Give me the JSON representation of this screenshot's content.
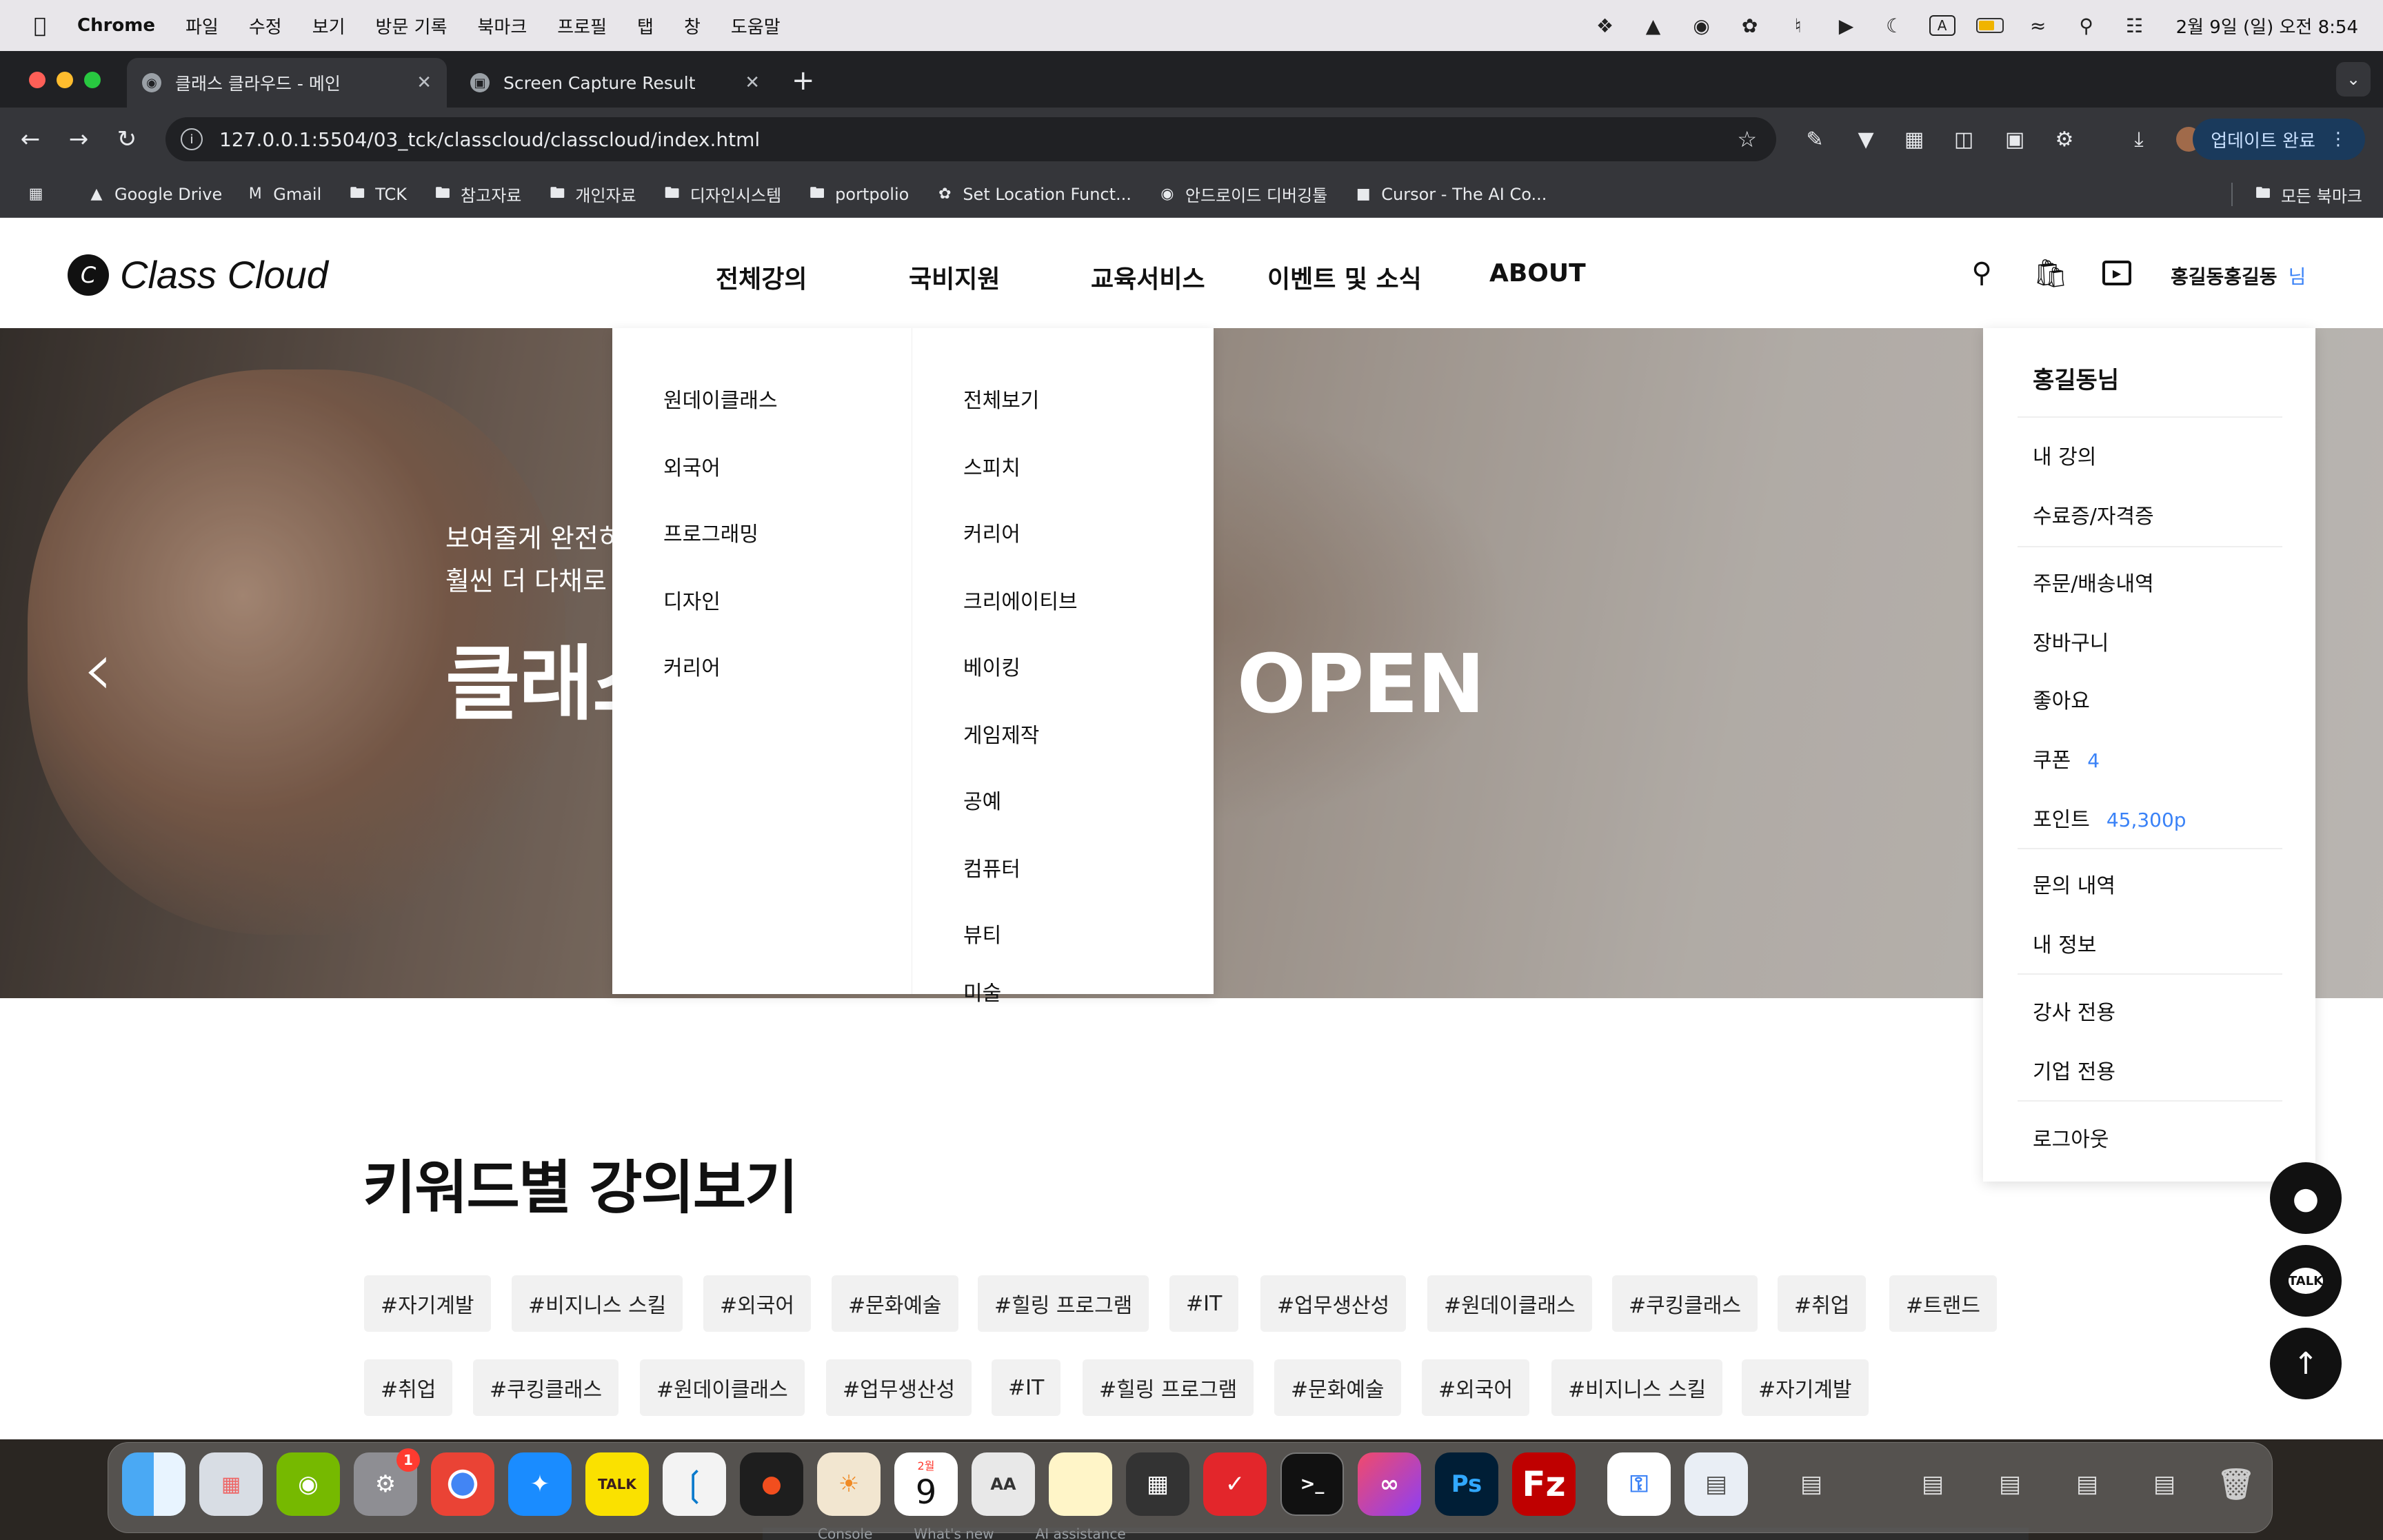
{
  "menubar": {
    "app": "Chrome",
    "items": [
      "파일",
      "수정",
      "보기",
      "방문 기록",
      "북마크",
      "프로필",
      "탭",
      "창",
      "도움말"
    ],
    "clock": "2월 9일 (일) 오전 8:54",
    "input_source": "A"
  },
  "tabs": [
    {
      "title": "클래스 클라우드 - 메인",
      "active": true
    },
    {
      "title": "Screen Capture Result",
      "active": false
    }
  ],
  "toolbar": {
    "url": "127.0.0.1:5504/03_tck/classcloud/classcloud/index.html",
    "update_label": "업데이트 완료"
  },
  "bookmarks": {
    "items": [
      "Google Drive",
      "Gmail",
      "TCK",
      "참고자료",
      "개인자료",
      "디자인시스템",
      "portpolio",
      "Set Location Funct...",
      "안드로이드 디버깅툴",
      "Cursor - The AI Co..."
    ],
    "all_label": "모든 북마크"
  },
  "site": {
    "logo": "Class Cloud",
    "logo_mark": "C",
    "nav": [
      "전체강의",
      "국비지원",
      "교육서비스",
      "이벤트 및 소식",
      "ABOUT"
    ],
    "user_name": "홍길동홍길동",
    "user_suffix": "님"
  },
  "hero": {
    "line1": "보여줄게 완전히",
    "line2": "훨씬 더 다채로",
    "title_left": "클래스",
    "title_right": "OPEN"
  },
  "mega_menu": {
    "col1": [
      "원데이클래스",
      "외국어",
      "프로그래밍",
      "디자인",
      "커리어"
    ],
    "col2": [
      "전체보기",
      "스피치",
      "커리어",
      "크리에이티브",
      "베이킹",
      "게임제작",
      "공예",
      "컴퓨터",
      "뷰티",
      "미술"
    ]
  },
  "user_menu": {
    "name": "홍길동님",
    "items": [
      {
        "label": "내 강의"
      },
      {
        "label": "수료증/자격증"
      },
      {
        "label": "주문/배송내역"
      },
      {
        "label": "장바구니"
      },
      {
        "label": "좋아요"
      },
      {
        "label": "쿠폰",
        "value": "4"
      },
      {
        "label": "포인트",
        "value": "45,300p"
      },
      {
        "label": "문의 내역"
      },
      {
        "label": "내 정보"
      },
      {
        "label": "강사 전용"
      },
      {
        "label": "기업 전용"
      },
      {
        "label": "로그아웃"
      }
    ]
  },
  "keywords": {
    "title": "키워드별 강의보기",
    "row1": [
      "#자기계발",
      "#비지니스 스킬",
      "#외국어",
      "#문화예술",
      "#힐링 프로그램",
      "#IT",
      "#업무생산성",
      "#원데이클래스",
      "#쿠킹클래스",
      "#취업",
      "#트랜드"
    ],
    "row2": [
      "#취업",
      "#쿠킹클래스",
      "#원데이클래스",
      "#업무생산성",
      "#IT",
      "#힐링 프로그램",
      "#문화예술",
      "#외국어",
      "#비지니스 스킬",
      "#자기계발"
    ]
  },
  "fabs": {
    "talk": "TALK"
  },
  "dock": {
    "apps": [
      "Finder",
      "Launchpad",
      "NVIDIA",
      "System Settings",
      "Chrome",
      "Safari",
      "KakaoTalk",
      "VS Code",
      "Figma",
      "Hammerspoon",
      "Calendar",
      "Fonts",
      "Notes",
      "Calculator",
      "Readdle",
      "Terminal",
      "Creative Cloud",
      "Photoshop",
      "FileZilla",
      "Passwords",
      "Preview"
    ],
    "settings_badge": "1",
    "calendar_month": "2월",
    "calendar_day": "9"
  },
  "devtools": [
    "Console",
    "What's new",
    "AI assistance"
  ]
}
